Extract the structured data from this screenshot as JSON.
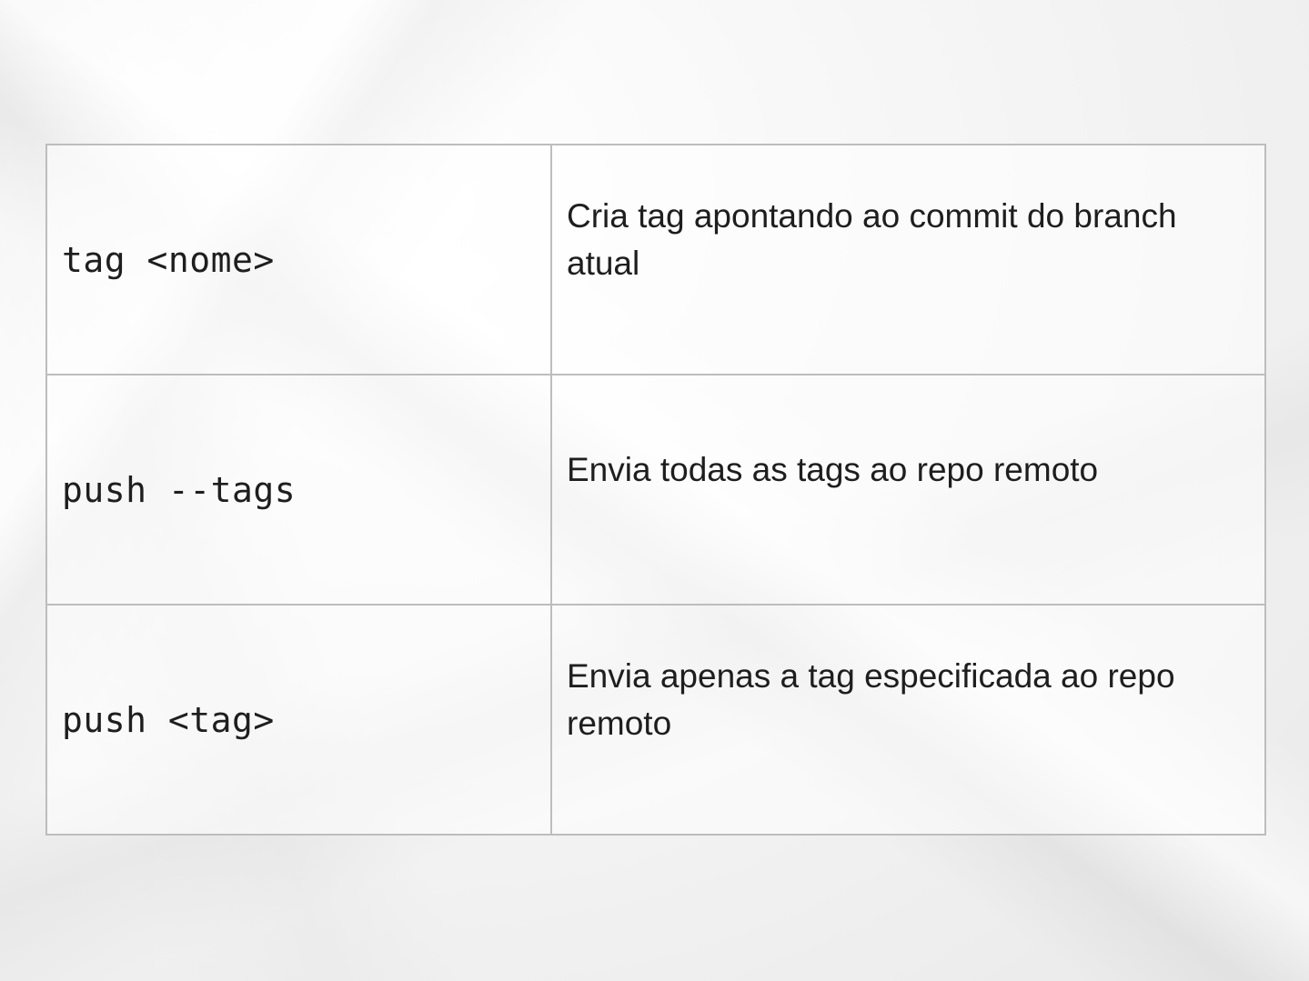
{
  "table": {
    "rows": [
      {
        "command": "tag <nome>",
        "description": "Cria tag apontando ao commit do branch atual"
      },
      {
        "command": "push --tags",
        "description": "Envia todas as tags ao repo remoto"
      },
      {
        "command": "push <tag>",
        "description": "Envia apenas a tag especificada ao repo remoto"
      }
    ]
  }
}
